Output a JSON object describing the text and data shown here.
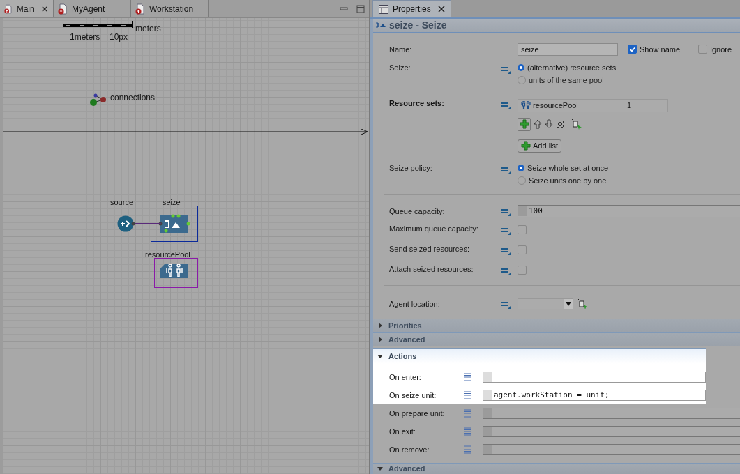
{
  "editor_tabs": [
    {
      "label": "Main",
      "selected": true
    },
    {
      "label": "MyAgent",
      "selected": false
    },
    {
      "label": "Workstation",
      "selected": false
    }
  ],
  "canvas": {
    "scale_unit": "meters",
    "scale_caption": "1meters = 10px",
    "connections_label": "connections",
    "blocks": [
      {
        "kind": "source",
        "label": "source"
      },
      {
        "kind": "seize",
        "label": "seize"
      },
      {
        "kind": "resource_pool",
        "label": "resourcePool"
      }
    ]
  },
  "properties": {
    "tab": "Properties",
    "header": "seize - Seize",
    "name": {
      "label": "Name:",
      "value": "seize"
    },
    "show_name": {
      "label": "Show name",
      "checked": true
    },
    "ignore": {
      "label": "Ignore",
      "checked": false
    },
    "seize": {
      "label": "Seize:",
      "options": [
        {
          "label": "(alternative) resource sets",
          "selected": true
        },
        {
          "label": "units of the same pool",
          "selected": false
        }
      ]
    },
    "resource_sets": {
      "label": "Resource sets:",
      "rows": [
        {
          "pool": "resourcePool",
          "count": "1"
        }
      ],
      "add_list": "Add list"
    },
    "seize_policy": {
      "label": "Seize policy:",
      "options": [
        {
          "label": "Seize whole set at once",
          "selected": true
        },
        {
          "label": "Seize units one by one",
          "selected": false
        }
      ]
    },
    "queue_capacity": {
      "label": "Queue capacity:",
      "value": "100"
    },
    "checks": [
      {
        "label": "Maximum queue capacity:",
        "checked": false
      },
      {
        "label": "Send seized resources:",
        "checked": false
      },
      {
        "label": "Attach seized resources:",
        "checked": false
      }
    ],
    "agent_location": {
      "label": "Agent location:"
    },
    "sections": [
      {
        "title": "Priorities",
        "expanded": false,
        "highlighted": false
      },
      {
        "title": "Advanced",
        "expanded": false,
        "highlighted": false
      },
      {
        "title": "Actions",
        "expanded": true,
        "highlighted": true
      }
    ],
    "actions": [
      {
        "label": "On enter:",
        "highlighted": true
      },
      {
        "label": "On seize unit:",
        "value": "agent.workStation = unit;",
        "highlighted": true
      },
      {
        "label": "On prepare unit:",
        "highlighted": false
      },
      {
        "label": "On exit:",
        "highlighted": false
      },
      {
        "label": "On remove:",
        "highlighted": false
      }
    ],
    "footer_section": {
      "title": "Advanced",
      "expanded": true
    }
  }
}
